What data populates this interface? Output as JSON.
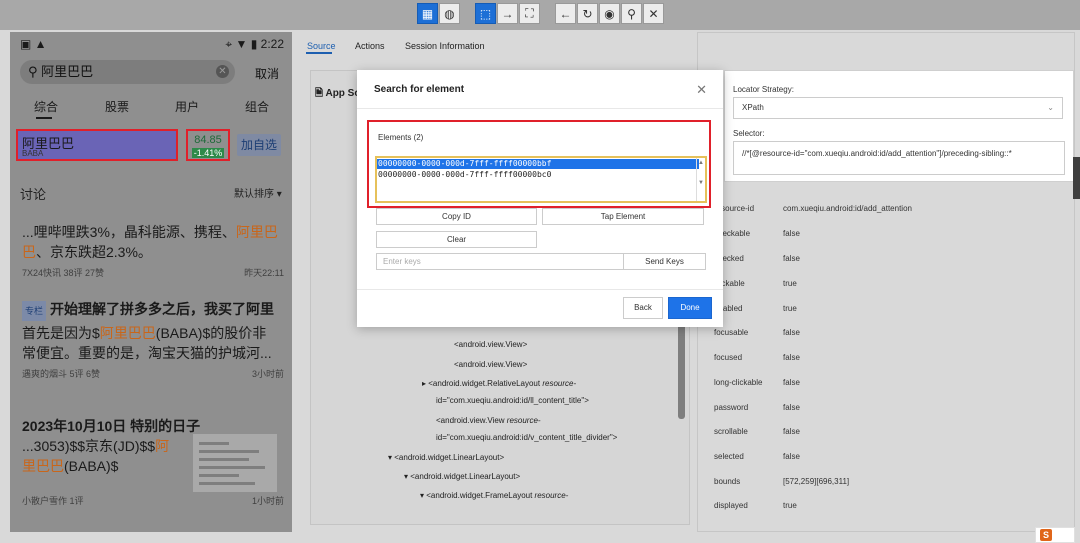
{
  "toolbar": {
    "buttons": [
      {
        "icon": "grid-icon",
        "glyph": "▦",
        "active": true
      },
      {
        "icon": "globe-icon",
        "glyph": "◍",
        "active": false
      },
      {
        "icon": "select-icon",
        "glyph": "⬚",
        "active": true
      },
      {
        "icon": "swipe-icon",
        "glyph": "→",
        "active": false
      },
      {
        "icon": "tap-by-coordinates-icon",
        "glyph": "⛶",
        "active": false
      },
      {
        "icon": "back-icon",
        "glyph": "←",
        "active": false
      },
      {
        "icon": "refresh-icon",
        "glyph": "↻",
        "active": false
      },
      {
        "icon": "eye-icon",
        "glyph": "◉",
        "active": false
      },
      {
        "icon": "search-icon",
        "glyph": "⚲",
        "active": false
      },
      {
        "icon": "close-icon",
        "glyph": "✕",
        "active": false
      }
    ]
  },
  "phone": {
    "status_time": "2:22",
    "search_text": "阿里巴巴",
    "cancel": "取消",
    "tabs": [
      "综合",
      "股票",
      "用户",
      "组合"
    ],
    "stock_name": "阿里巴巴",
    "stock_code": "BABA",
    "price": "84.85",
    "change": "-1.41%",
    "follow": "加自选",
    "section_title": "讨论",
    "sort": "默认排序",
    "posts": [
      {
        "body_pre": "...哩哔哩跌3%，晶科能源、携程、",
        "body_hl": "阿里巴",
        "body2_hl": "巴",
        "body2_post": "、京东跌超2.3%。",
        "meta": "7X24快讯  38评  27赞",
        "time": "昨天22:11"
      },
      {
        "tag": "专栏",
        "title": "开始理解了拼多多之后，我买了阿里",
        "body1_pre": "首先是因为$",
        "body1_hl": "阿里巴巴",
        "body1_post": "(BABA)$的股价非",
        "body2": "常便宜。重要的是，淘宝天猫的护城河...",
        "meta": "遇爽的烟斗  5评  6赞",
        "time": "3小时前"
      },
      {
        "title": "2023年10月10日 特别的日子",
        "body1_pre": "...3053)$$京东(JD)$$",
        "body1_hl": "阿",
        "body2_hl": "里巴巴",
        "body2_post": "(BABA)$",
        "meta": "小散户雪作  1评",
        "time": "1小时前"
      }
    ]
  },
  "inspector": {
    "tabs": [
      "Source",
      "Actions",
      "Session Information"
    ],
    "app_source": "App Source",
    "tree": [
      {
        "text": "android.view.View>",
        "indent": 154,
        "caret": ""
      },
      {
        "text": "android.view.View>",
        "indent": 154,
        "caret": ""
      },
      {
        "text": "android.widget.RelativeLayout",
        "attr": "resource-",
        "indent": 136,
        "caret": "▸"
      },
      {
        "text": "id=\"com.xueqiu.android:id/ll_content_title\">",
        "indent": 136,
        "caret": "",
        "plain": true
      },
      {
        "text": "android.view.View",
        "attr": "resource-",
        "indent": 136,
        "caret": ""
      },
      {
        "text": "id=\"com.xueqiu.android:id/v_content_title_divider\">",
        "indent": 136,
        "caret": "",
        "plain": true
      },
      {
        "text": "android.widget.LinearLayout>",
        "indent": 104,
        "caret": "▾"
      },
      {
        "text": "android.widget.LinearLayout>",
        "indent": 120,
        "caret": "▾"
      },
      {
        "text": "android.widget.FrameLayout",
        "attr": "resource-",
        "indent": 136,
        "caret": "▾"
      }
    ]
  },
  "selected_element": {
    "locator_label": "Locator Strategy:",
    "locator_value": "XPath",
    "selector_label": "Selector:",
    "selector_value": "//*[@resource-id=\"com.xueqiu.android:id/add_attention\"]/preceding-sibling::*",
    "attributes": [
      {
        "k": "resource-id",
        "v": "com.xueqiu.android:id/add_attention"
      },
      {
        "k": "checkable",
        "v": "false"
      },
      {
        "k": "checked",
        "v": "false"
      },
      {
        "k": "clickable",
        "v": "true"
      },
      {
        "k": "enabled",
        "v": "true"
      },
      {
        "k": "focusable",
        "v": "false"
      },
      {
        "k": "focused",
        "v": "false"
      },
      {
        "k": "long-clickable",
        "v": "false"
      },
      {
        "k": "password",
        "v": "false"
      },
      {
        "k": "scrollable",
        "v": "false"
      },
      {
        "k": "selected",
        "v": "false"
      },
      {
        "k": "bounds",
        "v": "[572,259][696,311]"
      },
      {
        "k": "displayed",
        "v": "true"
      }
    ]
  },
  "modal": {
    "title": "Search for element",
    "elements_label": "Elements (2)",
    "elements": [
      "00000000-0000-000d-7fff-ffff00000bbf",
      "00000000-0000-000d-7fff-ffff00000bc0"
    ],
    "selected_index": 0,
    "copy_id": "Copy ID",
    "tap_element": "Tap Element",
    "clear": "Clear",
    "keys_placeholder": "Enter keys",
    "send_keys": "Send Keys",
    "back": "Back",
    "done": "Done"
  },
  "colors": {
    "accent": "#1e73e8",
    "highlight_border": "#e0202a",
    "stock_text": "#c9661a"
  }
}
